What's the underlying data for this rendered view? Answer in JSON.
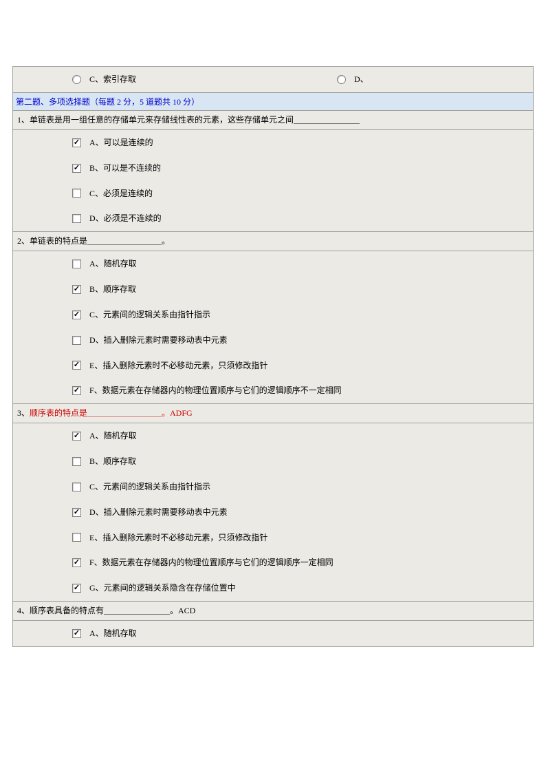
{
  "top_radio": {
    "c_label": "C、索引存取",
    "d_label": "D、"
  },
  "section2_header": "第二题、多项选择题（每题 2 分，5 道题共 10 分）",
  "questions": [
    {
      "prompt": "1、单链表是用一组任意的存储单元来存储线性表的元素，这些存储单元之间＿＿＿＿＿＿＿＿",
      "highlight": "",
      "suffix": "",
      "options": [
        {
          "label": "A、可以是连续的",
          "checked": true
        },
        {
          "label": "B、可以是不连续的",
          "checked": true
        },
        {
          "label": "C、必须是连续的",
          "checked": false
        },
        {
          "label": "D、必须是不连续的",
          "checked": false
        }
      ]
    },
    {
      "prompt": "2、单链表的特点是＿＿＿＿＿＿＿＿＿。",
      "highlight": "",
      "suffix": "",
      "options": [
        {
          "label": "A、随机存取",
          "checked": false
        },
        {
          "label": "B、顺序存取",
          "checked": true
        },
        {
          "label": "C、元素间的逻辑关系由指针指示",
          "checked": true
        },
        {
          "label": "D、插入删除元素时需要移动表中元素",
          "checked": false
        },
        {
          "label": "E、插入删除元素时不必移动元素，只须修改指针",
          "checked": true
        },
        {
          "label": "F、数据元素在存储器内的物理位置顺序与它们的逻辑顺序不一定相同",
          "checked": true
        }
      ]
    },
    {
      "prompt": "3、",
      "highlight": "顺序表的特点是＿＿＿＿＿＿＿＿＿。ADFG",
      "suffix": "",
      "options": [
        {
          "label": "A、随机存取",
          "checked": true
        },
        {
          "label": "B、顺序存取",
          "checked": false
        },
        {
          "label": "C、元素间的逻辑关系由指针指示",
          "checked": false
        },
        {
          "label": "D、插入删除元素时需要移动表中元素",
          "checked": true
        },
        {
          "label": "E、插入删除元素时不必移动元素，只须修改指针",
          "checked": false
        },
        {
          "label": "F、数据元素在存储器内的物理位置顺序与它们的逻辑顺序一定相同",
          "checked": true
        },
        {
          "label": "G、元素间的逻辑关系隐含在存储位置中",
          "checked": true
        }
      ]
    },
    {
      "prompt": "4、顺序表具备的特点有＿＿＿＿＿＿＿＿。ACD",
      "highlight": "",
      "suffix": "",
      "options": [
        {
          "label": "A、随机存取",
          "checked": true
        }
      ]
    }
  ]
}
